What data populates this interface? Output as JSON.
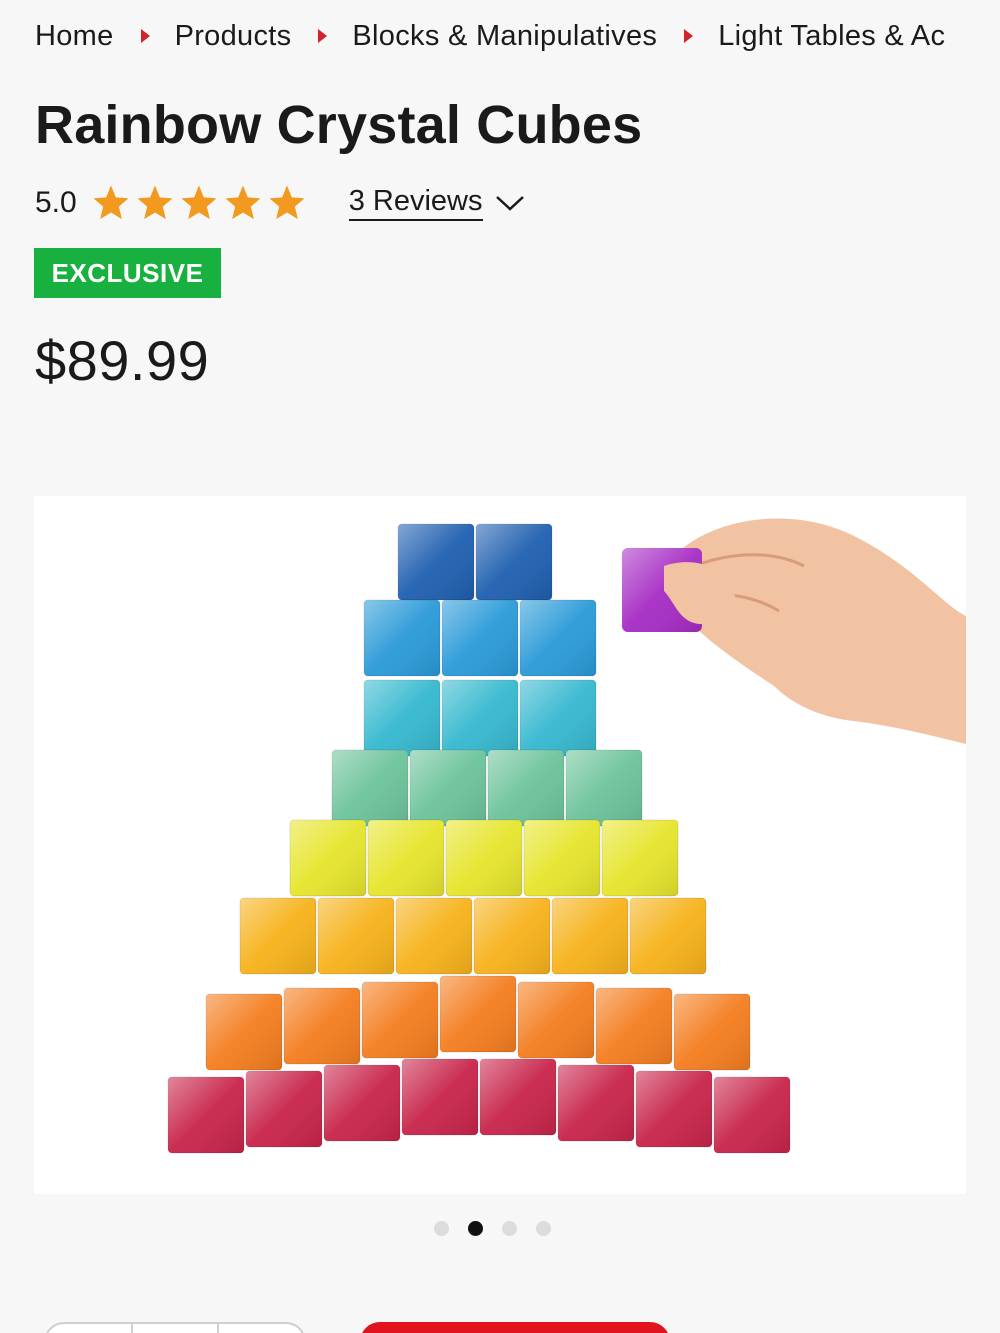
{
  "breadcrumb": {
    "items": [
      "Home",
      "Products",
      "Blocks & Manipulatives",
      "Light Tables & Ac"
    ]
  },
  "product": {
    "title": "Rainbow Crystal Cubes",
    "rating": "5.0",
    "star_count": 5,
    "reviews_label": "3 Reviews",
    "badge": "EXCLUSIVE",
    "price": "$89.99"
  },
  "carousel": {
    "slides": 4,
    "active_index": 1
  },
  "colors": {
    "accent_red": "#d2232a",
    "star": "#f29a1f",
    "badge_green": "#18b13f",
    "cta_red": "#e1131f"
  },
  "icons": {
    "breadcrumb_separator": "caret-right-icon",
    "star": "star-icon",
    "reviews_toggle": "chevron-down-icon"
  }
}
